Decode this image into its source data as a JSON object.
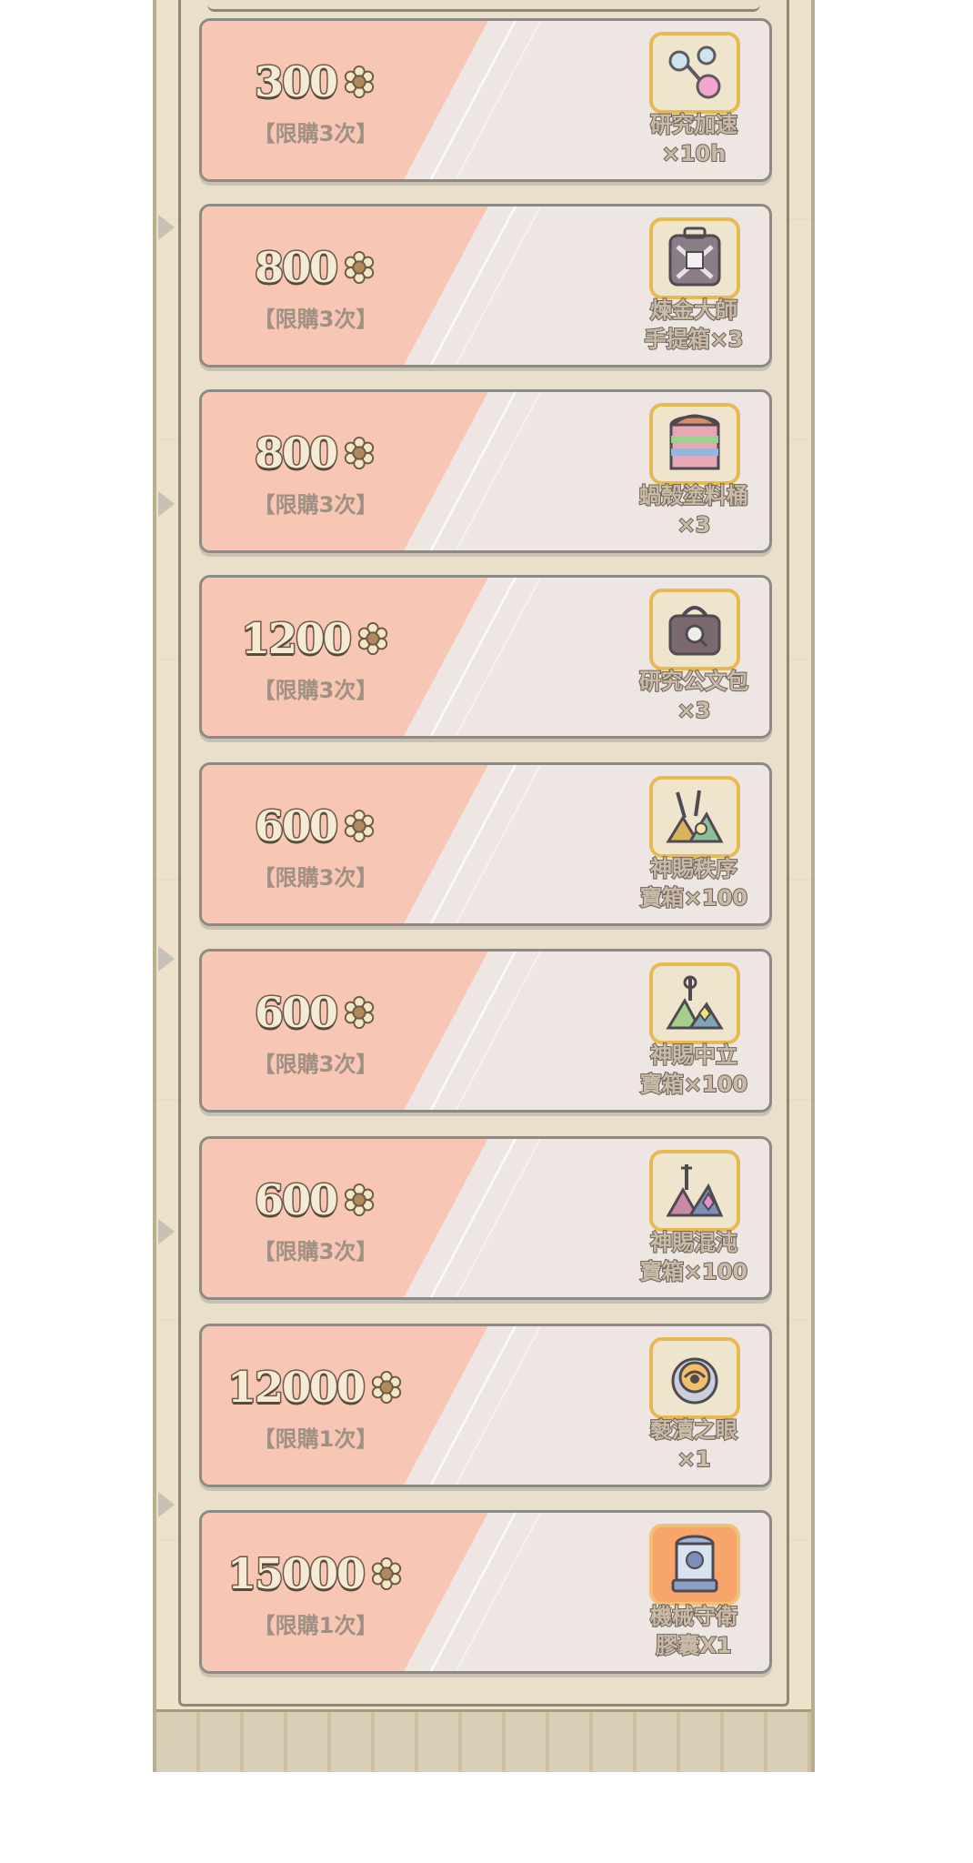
{
  "shop": {
    "items": [
      {
        "price": "300",
        "limit": "【限購3次】",
        "name_line1": "研究加速",
        "name_line2": "×10h",
        "icon": "research-potion-icon"
      },
      {
        "price": "800",
        "limit": "【限購3次】",
        "name_line1": "煉金大師",
        "name_line2": "手提箱×3",
        "icon": "alchemist-suitcase-icon"
      },
      {
        "price": "800",
        "limit": "【限購3次】",
        "name_line1": "蝸殼塗料桶",
        "name_line2": "×3",
        "icon": "paint-bucket-icon"
      },
      {
        "price": "1200",
        "limit": "【限購3次】",
        "name_line1": "研究公文包",
        "name_line2": "×3",
        "icon": "briefcase-icon"
      },
      {
        "price": "600",
        "limit": "【限購3次】",
        "name_line1": "神賜秩序",
        "name_line2": "寶箱×100",
        "icon": "order-chest-icon"
      },
      {
        "price": "600",
        "limit": "【限購3次】",
        "name_line1": "神賜中立",
        "name_line2": "寶箱×100",
        "icon": "neutral-chest-icon"
      },
      {
        "price": "600",
        "limit": "【限購3次】",
        "name_line1": "神賜混沌",
        "name_line2": "寶箱×100",
        "icon": "chaos-chest-icon"
      },
      {
        "price": "12000",
        "limit": "【限購1次】",
        "name_line1": "褻瀆之眼",
        "name_line2": "×1",
        "icon": "profane-eye-icon"
      },
      {
        "price": "15000",
        "limit": "【限購1次】",
        "name_line1": "機械守衛",
        "name_line2": "膠囊X1",
        "icon": "mech-guard-capsule-icon"
      }
    ]
  },
  "colors": {
    "stripe": "#f7c6b5",
    "card": "#ede6e3",
    "frame": "#eee3ca",
    "icon_border": "#e7b955",
    "icon_border_special": "#f1c078",
    "icon_bg_special": "#f7a56a"
  }
}
